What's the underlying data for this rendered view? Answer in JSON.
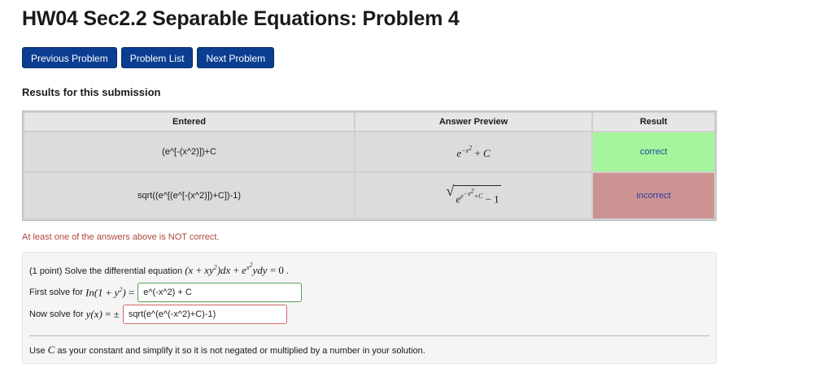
{
  "page": {
    "title": "HW04 Sec2.2 Separable Equations: Problem 4"
  },
  "nav": {
    "previous_label": "Previous Problem",
    "list_label": "Problem List",
    "next_label": "Next Problem"
  },
  "results": {
    "heading": "Results for this submission",
    "headers": {
      "entered": "Entered",
      "preview": "Answer Preview",
      "result": "Result"
    },
    "rows": [
      {
        "entered": "(e^[-(x^2)])+C",
        "result": "correct"
      },
      {
        "entered": "sqrt((e^[(e^[-(x^2)])+C])-1)",
        "result": "incorrect"
      }
    ],
    "colors": {
      "correct_bg": "#a5f59c",
      "incorrect_bg": "#cc9393"
    }
  },
  "warning": "At least one of the answers above is NOT correct.",
  "problem": {
    "statement_prefix": "(1 point) Solve the differential equation",
    "q1_label": "First solve for",
    "q1_answer": "e^(-x^2) + C",
    "q2_label": "Now solve for",
    "q2_answer": "sqrt(e^(e^(-x^2)+C)-1)",
    "hint_prefix": "Use",
    "hint_suffix": "as your constant and simplify it so it is not negated or multiplied by a number in your solution."
  },
  "colors": {
    "nav_button_bg": "#0b3d91",
    "warning_text": "#b0473c"
  }
}
